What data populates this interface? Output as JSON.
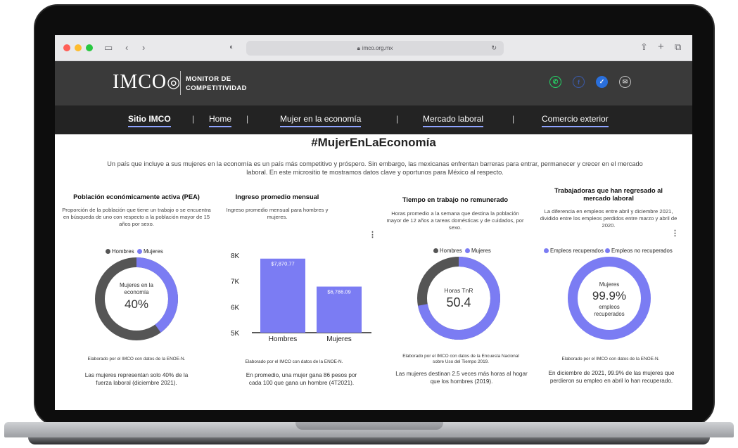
{
  "browser": {
    "url": "imco.org.mx"
  },
  "site": {
    "logo": "IMCO",
    "tagline_line1": "MONITOR DE",
    "tagline_line2": "COMPETITIVIDAD",
    "social_icons": [
      "whatsapp-icon",
      "facebook-icon",
      "twitter-icon",
      "email-icon"
    ]
  },
  "nav": {
    "items": [
      "Sitio IMCO",
      "Home",
      "Mujer en la economía",
      "Mercado laboral",
      "Comercio exterior"
    ],
    "separator": "|"
  },
  "main": {
    "hashtag": "#MujerEnLaEconomía",
    "intro": "Un país que incluye a sus mujeres en la economía es un país más competitivo y próspero. Sin embargo, las mexicanas enfrentan barreras para entrar, permanecer y crecer en el mercado laboral. En este micrositio te mostramos datos clave y oportunos para México al respecto."
  },
  "colors": {
    "mujeres": "#7b7cf3",
    "hombres": "#555555",
    "accent_underline": "#8ea3ff"
  },
  "cards": [
    {
      "title": "Población económicamente activa (PEA)",
      "desc": "Proporción de la población que tiene un trabajo o se encuentra en búsqueda de uno con respecto a la población mayor de 15 años por sexo.",
      "legend": [
        "Hombres",
        "Mujeres"
      ],
      "center_label": "Mujeres en la economía",
      "center_value": "40%",
      "credit": "Elaborado por el IMCO con datos de la ENOE-N.",
      "note": "Las mujeres representan solo 40% de la fuerza laboral (diciembre 2021)."
    },
    {
      "title": "Ingreso promedio mensual",
      "desc": "Ingreso promedio mensual para hombres y mujeres.",
      "credit": "Elaborado por el IMCO con datos de la ENOE-N.",
      "note": "En promedio, una mujer gana 86 pesos por cada 100 que gana un hombre (4T2021)."
    },
    {
      "title": "Tiempo en trabajo no remunerado",
      "desc": "Horas promedio a la semana que destina la población mayor de 12 años a tareas domésticas y de cuidados, por sexo.",
      "legend": [
        "Hombres",
        "Mujeres"
      ],
      "center_label": "Horas TnR",
      "center_value": "50.4",
      "credit": "Elaborado por el IMCO con datos de la Encuesta Nacional sobre Uso del Tiempo 2019.",
      "note": "Las mujeres destinan 2.5 veces más horas al hogar que los hombres (2019)."
    },
    {
      "title": "Trabajadoras que han regresado al mercado laboral",
      "desc": "La diferencia en empleos entre abril y diciembre 2021, dividido entre los empleos perdidos entre marzo y abril de 2020.",
      "legend": [
        "Empleos recuperados",
        "Empleos no recuperados"
      ],
      "center_label": "Mujeres",
      "center_value": "99.9%",
      "center_sub": "empleos recuperados",
      "credit": "Elaborado por el IMCO con datos de la ENOE-N.",
      "note": "En diciembre de 2021, 99.9% de las mujeres que perdieron su empleo en abril lo han recuperado."
    }
  ],
  "chart_data": [
    {
      "type": "pie",
      "labels": [
        "Mujeres",
        "Hombres"
      ],
      "values": [
        40,
        60
      ]
    },
    {
      "type": "bar",
      "categories": [
        "Hombres",
        "Mujeres"
      ],
      "values": [
        7870.77,
        6786.09
      ],
      "data_labels": [
        "$7,870.77",
        "$6,786.09"
      ],
      "ylim": [
        5000,
        8000
      ],
      "yticks": [
        "5K",
        "6K",
        "7K",
        "8K"
      ]
    },
    {
      "type": "pie",
      "labels": [
        "Mujeres",
        "Hombres"
      ],
      "values": [
        72,
        28
      ]
    },
    {
      "type": "pie",
      "labels": [
        "Empleos recuperados",
        "Empleos no recuperados"
      ],
      "values": [
        99.9,
        0.1
      ]
    }
  ]
}
